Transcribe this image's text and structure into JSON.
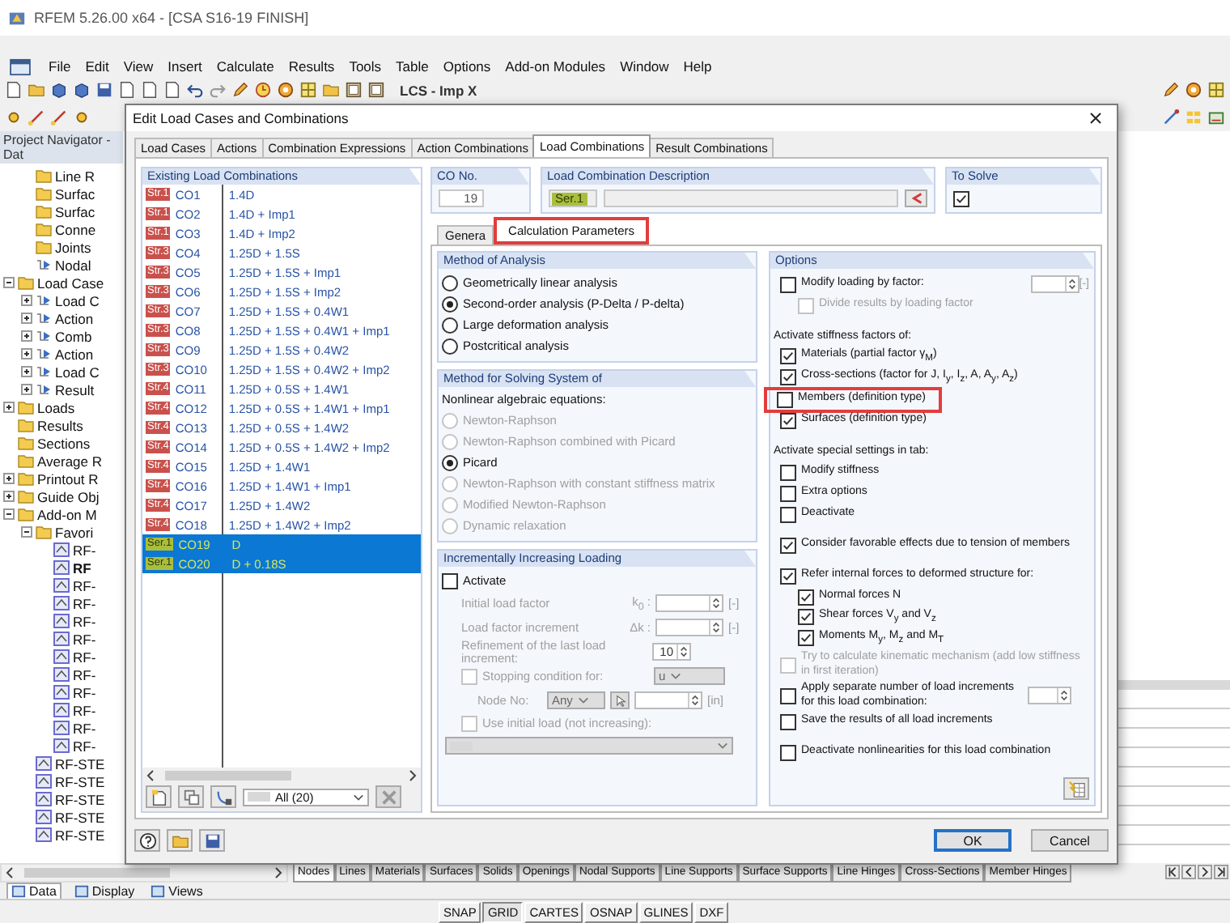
{
  "app": {
    "title": "RFEM 5.26.00 x64 - [CSA S16-19 FINISH]"
  },
  "menu": [
    "File",
    "Edit",
    "View",
    "Insert",
    "Calculate",
    "Results",
    "Tools",
    "Table",
    "Options",
    "Add-on Modules",
    "Window",
    "Help"
  ],
  "toolbar": {
    "combo": "LCS - Imp X"
  },
  "navigator": {
    "title": "Project Navigator - Dat",
    "upper_items": [
      {
        "label": "Line R",
        "kind": "folder"
      },
      {
        "label": "Surfac",
        "kind": "folder"
      },
      {
        "label": "Surfac",
        "kind": "folder"
      },
      {
        "label": "Conne",
        "kind": "folder"
      },
      {
        "label": "Joints",
        "kind": "folder"
      },
      {
        "label": "Nodal",
        "kind": "item"
      }
    ],
    "tree": [
      {
        "label": "Load Case",
        "kind": "folder",
        "expanded": true,
        "children": [
          {
            "label": "Load C",
            "kind": "item",
            "expanded": false
          },
          {
            "label": "Action",
            "kind": "item",
            "expanded": false
          },
          {
            "label": "Comb",
            "kind": "item",
            "expanded": false
          },
          {
            "label": "Action",
            "kind": "item",
            "expanded": false
          },
          {
            "label": "Load C",
            "kind": "item",
            "expanded": false
          },
          {
            "label": "Result",
            "kind": "item",
            "expanded": false
          }
        ]
      },
      {
        "label": "Loads",
        "kind": "folder",
        "expanded": false
      },
      {
        "label": "Results",
        "kind": "folder"
      },
      {
        "label": "Sections",
        "kind": "folder"
      },
      {
        "label": "Average R",
        "kind": "folder"
      },
      {
        "label": "Printout R",
        "kind": "folder",
        "expanded": false
      },
      {
        "label": "Guide Obj",
        "kind": "folder",
        "expanded": false
      },
      {
        "label": "Add-on M",
        "kind": "folder",
        "expanded": true,
        "children": [
          {
            "label": "Favori",
            "kind": "folder",
            "expanded": true,
            "children": [
              {
                "label": "RF-",
                "kind": "module"
              },
              {
                "label": "RF",
                "kind": "module",
                "bold": true
              },
              {
                "label": "RF-",
                "kind": "module"
              },
              {
                "label": "RF-",
                "kind": "module"
              },
              {
                "label": "RF-",
                "kind": "module"
              },
              {
                "label": "RF-",
                "kind": "module"
              },
              {
                "label": "RF-",
                "kind": "module"
              },
              {
                "label": "RF-",
                "kind": "module"
              },
              {
                "label": "RF-",
                "kind": "module"
              },
              {
                "label": "RF-",
                "kind": "module"
              },
              {
                "label": "RF-",
                "kind": "module"
              },
              {
                "label": "RF-",
                "kind": "module"
              }
            ]
          },
          {
            "label": "RF-STE",
            "kind": "module"
          },
          {
            "label": "RF-STE",
            "kind": "module"
          },
          {
            "label": "RF-STE",
            "kind": "module"
          },
          {
            "label": "RF-STE",
            "kind": "module"
          },
          {
            "label": "RF-STE",
            "kind": "module"
          }
        ]
      }
    ],
    "tabs": [
      {
        "label": "Data",
        "selected": true
      },
      {
        "label": "Display",
        "selected": false
      },
      {
        "label": "Views",
        "selected": false
      }
    ]
  },
  "dialog": {
    "title": "Edit Load Cases and Combinations",
    "tabs": [
      {
        "label": "Load Cases",
        "selected": false
      },
      {
        "label": "Actions",
        "selected": false
      },
      {
        "label": "Combination Expressions",
        "selected": false
      },
      {
        "label": "Action Combinations",
        "selected": false
      },
      {
        "label": "Load Combinations",
        "selected": true
      },
      {
        "label": "Result Combinations",
        "selected": false
      }
    ],
    "combinations": {
      "title": "Existing Load Combinations",
      "filter": "All (20)",
      "rows": [
        {
          "tag": "Str.1",
          "color": "#c9514c",
          "no": "CO1",
          "formula": "1.4D",
          "selected": false
        },
        {
          "tag": "Str.1",
          "color": "#c9514c",
          "no": "CO2",
          "formula": "1.4D + Imp1",
          "selected": false
        },
        {
          "tag": "Str.1",
          "color": "#c9514c",
          "no": "CO3",
          "formula": "1.4D + Imp2",
          "selected": false
        },
        {
          "tag": "Str.3",
          "color": "#c9514c",
          "no": "CO4",
          "formula": "1.25D + 1.5S",
          "selected": false
        },
        {
          "tag": "Str.3",
          "color": "#c9514c",
          "no": "CO5",
          "formula": "1.25D + 1.5S + Imp1",
          "selected": false
        },
        {
          "tag": "Str.3",
          "color": "#c9514c",
          "no": "CO6",
          "formula": "1.25D + 1.5S + Imp2",
          "selected": false
        },
        {
          "tag": "Str.3",
          "color": "#c9514c",
          "no": "CO7",
          "formula": "1.25D + 1.5S + 0.4W1",
          "selected": false
        },
        {
          "tag": "Str.3",
          "color": "#c9514c",
          "no": "CO8",
          "formula": "1.25D + 1.5S + 0.4W1 + Imp1",
          "selected": false
        },
        {
          "tag": "Str.3",
          "color": "#c9514c",
          "no": "CO9",
          "formula": "1.25D + 1.5S + 0.4W2",
          "selected": false
        },
        {
          "tag": "Str.3",
          "color": "#c9514c",
          "no": "CO10",
          "formula": "1.25D + 1.5S + 0.4W2 + Imp2",
          "selected": false
        },
        {
          "tag": "Str.4",
          "color": "#c9514c",
          "no": "CO11",
          "formula": "1.25D + 0.5S + 1.4W1",
          "selected": false
        },
        {
          "tag": "Str.4",
          "color": "#c9514c",
          "no": "CO12",
          "formula": "1.25D + 0.5S + 1.4W1 + Imp1",
          "selected": false
        },
        {
          "tag": "Str.4",
          "color": "#c9514c",
          "no": "CO13",
          "formula": "1.25D + 0.5S + 1.4W2",
          "selected": false
        },
        {
          "tag": "Str.4",
          "color": "#c9514c",
          "no": "CO14",
          "formula": "1.25D + 0.5S + 1.4W2 + Imp2",
          "selected": false
        },
        {
          "tag": "Str.4",
          "color": "#c9514c",
          "no": "CO15",
          "formula": "1.25D + 1.4W1",
          "selected": false
        },
        {
          "tag": "Str.4",
          "color": "#c9514c",
          "no": "CO16",
          "formula": "1.25D + 1.4W1 + Imp1",
          "selected": false
        },
        {
          "tag": "Str.4",
          "color": "#c9514c",
          "no": "CO17",
          "formula": "1.25D + 1.4W2",
          "selected": false
        },
        {
          "tag": "Str.4",
          "color": "#c9514c",
          "no": "CO18",
          "formula": "1.25D + 1.4W2 + Imp2",
          "selected": false
        },
        {
          "tag": "Ser.1",
          "color": "#a9bf3c",
          "no": "CO19",
          "formula": "D",
          "selected": true
        },
        {
          "tag": "Ser.1",
          "color": "#a9bf3c",
          "no": "CO20",
          "formula": "D + 0.18S",
          "selected": true
        }
      ]
    },
    "co_no": {
      "label": "CO No.",
      "value": "19"
    },
    "description": {
      "label": "Load Combination Description",
      "tag": {
        "label": "Ser.1",
        "color": "#a9bf3c"
      }
    },
    "to_solve": {
      "label": "To Solve",
      "checked": true
    },
    "subtabs": [
      {
        "label": "Genera",
        "selected": false,
        "highlighted": false
      },
      {
        "label": "Calculation Parameters",
        "selected": true,
        "highlighted": true
      }
    ],
    "method_of_analysis": {
      "title": "Method of Analysis",
      "options": [
        {
          "label": "Geometrically linear analysis",
          "selected": false
        },
        {
          "label": "Second-order analysis (P-Delta / P-delta)",
          "selected": true
        },
        {
          "label": "Large deformation analysis",
          "selected": false
        },
        {
          "label": "Postcritical analysis",
          "selected": false
        }
      ]
    },
    "solving": {
      "title": "Method for Solving System of",
      "subtitle": "Nonlinear algebraic equations:",
      "options": [
        {
          "label": "Newton-Raphson",
          "selected": false,
          "disabled": true
        },
        {
          "label": "Newton-Raphson combined with Picard",
          "selected": false,
          "disabled": true
        },
        {
          "label": "Picard",
          "selected": true,
          "disabled": false
        },
        {
          "label": "Newton-Raphson with constant stiffness matrix",
          "selected": false,
          "disabled": true
        },
        {
          "label": "Modified Newton-Raphson",
          "selected": false,
          "disabled": true
        },
        {
          "label": "Dynamic relaxation",
          "selected": false,
          "disabled": true
        }
      ]
    },
    "incremental": {
      "title": "Incrementally Increasing Loading",
      "items": [
        {
          "kind": "check",
          "label": "Activate",
          "checked": false,
          "disabled": false
        },
        {
          "kind": "spin",
          "label": "Initial load factor",
          "symbol": "k$_{0}$ :",
          "unit": "[-]",
          "disabled": true
        },
        {
          "kind": "spin",
          "label": "Load factor increment",
          "symbol": "Δk :",
          "unit": "[-]",
          "disabled": true
        },
        {
          "kind": "spin",
          "label": "Refinement of the last load increment:",
          "value": "10",
          "disabled": true
        },
        {
          "kind": "check_select",
          "label": "Stopping condition for:",
          "checked": false,
          "disabled": true,
          "value": "u"
        },
        {
          "kind": "node",
          "label": "Node No:",
          "value": "Any",
          "unit": "[in]",
          "disabled": true
        },
        {
          "kind": "check",
          "label": "Use initial load (not increasing):",
          "checked": false,
          "disabled": true
        },
        {
          "kind": "select",
          "disabled": true
        }
      ]
    },
    "options": {
      "title": "Options",
      "sections": [
        [
          {
            "kind": "check_spin",
            "label": "Modify loading by factor:",
            "checked": false,
            "disabled": false,
            "unit": "[-]",
            "children": [
              {
                "kind": "check",
                "label": "Divide results by loading factor",
                "checked": false,
                "disabled": true
              }
            ]
          }
        ],
        [
          {
            "kind": "label",
            "label": "Activate stiffness factors of:"
          },
          {
            "kind": "check",
            "label": "Materials (partial factor γ$_{M}$)",
            "checked": true,
            "disabled": false
          },
          {
            "kind": "check",
            "label": "Cross-sections (factor for J, I$_{y}$, I$_{z}$, A, A$_{y}$, A$_{z}$)",
            "checked": true,
            "disabled": false
          },
          {
            "kind": "check",
            "label": "Members (definition type)",
            "checked": false,
            "disabled": false,
            "highlighted": true
          },
          {
            "kind": "check",
            "label": "Surfaces (definition type)",
            "checked": true,
            "disabled": false
          }
        ],
        [
          {
            "kind": "label",
            "label": "Activate special settings in tab:"
          },
          {
            "kind": "check",
            "label": "Modify stiffness",
            "checked": false,
            "disabled": false
          },
          {
            "kind": "check",
            "label": "Extra options",
            "checked": false,
            "disabled": false
          },
          {
            "kind": "check",
            "label": "Deactivate",
            "checked": false,
            "disabled": false
          }
        ],
        [
          {
            "kind": "check",
            "label": "Consider favorable effects due to tension of members",
            "checked": true,
            "disabled": false
          }
        ],
        [
          {
            "kind": "check",
            "label": "Refer internal forces to deformed structure for:",
            "checked": true,
            "disabled": false,
            "children": [
              {
                "kind": "check",
                "label": "Normal forces N",
                "checked": true,
                "disabled": false
              },
              {
                "kind": "check",
                "label": "Shear forces V$_{y}$ and V$_{z}$",
                "checked": true,
                "disabled": false
              },
              {
                "kind": "check",
                "label": "Moments M$_{y}$, M$_{z}$ and M$_{T}$",
                "checked": true,
                "disabled": false
              }
            ]
          },
          {
            "kind": "check",
            "label": "Try to calculate kinematic mechanism (add low stiffness in first iteration)",
            "checked": false,
            "disabled": true
          },
          {
            "kind": "check_spin",
            "label": "Apply separate number of load increments for this load combination:",
            "checked": false,
            "disabled": false
          },
          {
            "kind": "check",
            "label": "Save the results of all load increments",
            "checked": false,
            "disabled": false
          }
        ],
        [
          {
            "kind": "check",
            "label": "Deactivate nonlinearities for this load combination",
            "checked": false,
            "disabled": false
          }
        ]
      ]
    },
    "buttons": [
      {
        "label": "OK",
        "default": true
      },
      {
        "label": "Cancel",
        "default": false
      }
    ]
  },
  "sheet_tabs": [
    {
      "label": "Nodes",
      "selected": true
    },
    {
      "label": "Lines",
      "selected": false
    },
    {
      "label": "Materials",
      "selected": false
    },
    {
      "label": "Surfaces",
      "selected": false
    },
    {
      "label": "Solids",
      "selected": false
    },
    {
      "label": "Openings",
      "selected": false
    },
    {
      "label": "Nodal Supports",
      "selected": false
    },
    {
      "label": "Line Supports",
      "selected": false
    },
    {
      "label": "Surface Supports",
      "selected": false
    },
    {
      "label": "Line Hinges",
      "selected": false
    },
    {
      "label": "Cross-Sections",
      "selected": false
    },
    {
      "label": "Member Hinges",
      "selected": false
    }
  ],
  "status_bar": [
    {
      "label": "SNAP",
      "selected": false
    },
    {
      "label": "GRID",
      "selected": true
    },
    {
      "label": "CARTES",
      "selected": false
    },
    {
      "label": "OSNAP",
      "selected": false
    },
    {
      "label": "GLINES",
      "selected": false
    },
    {
      "label": "DXF",
      "selected": false
    }
  ]
}
